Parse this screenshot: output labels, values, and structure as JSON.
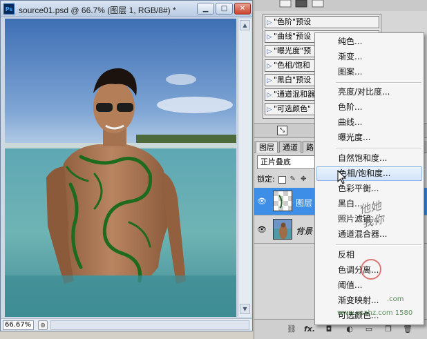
{
  "document": {
    "app_badge": "Ps",
    "title": "source01.psd @ 66.7% (图层 1, RGB/8#) *",
    "window_buttons": {
      "minimize": "▁",
      "maximize": "□",
      "close": "✕"
    },
    "zoom_level": "66.67%"
  },
  "adjustments": {
    "presets": [
      "\"色阶\"预设",
      "\"曲线\"预设",
      "\"曝光度\"预",
      "\"色相/饱和",
      "\"黑白\"预设",
      "\"通道混和器",
      "\"可选颜色\""
    ]
  },
  "layers_panel": {
    "tabs": [
      "图层",
      "通道",
      "路"
    ],
    "blend_mode": "正片叠底",
    "lock_label": "锁定:",
    "layers": [
      {
        "name": "图层",
        "selected": true,
        "italic": false
      },
      {
        "name": "背景",
        "selected": false,
        "italic": true
      }
    ],
    "bottom_fx": "fx."
  },
  "menu": {
    "groups": [
      [
        "纯色...",
        "渐变...",
        "图案..."
      ],
      [
        "亮度/对比度...",
        "色阶...",
        "曲线...",
        "曝光度..."
      ],
      [
        "自然饱和度...",
        "色相/饱和度...",
        "色彩平衡...",
        "黑白...",
        "照片滤镜...",
        "通道混合器..."
      ],
      [
        "反相",
        "色调分离...",
        "阈值...",
        "渐变映射...",
        "可选颜色..."
      ]
    ],
    "hovered": "色相/饱和度..."
  },
  "watermarks": {
    "script_text": "他她我你",
    "site_label": ".com",
    "site_url": "www.psahz.com  1580"
  },
  "colors": {
    "sky": "#6f95c8",
    "water": "#3f8fa0",
    "selection": "#3d8ee6",
    "menu_hover": "#d3e5fa"
  }
}
